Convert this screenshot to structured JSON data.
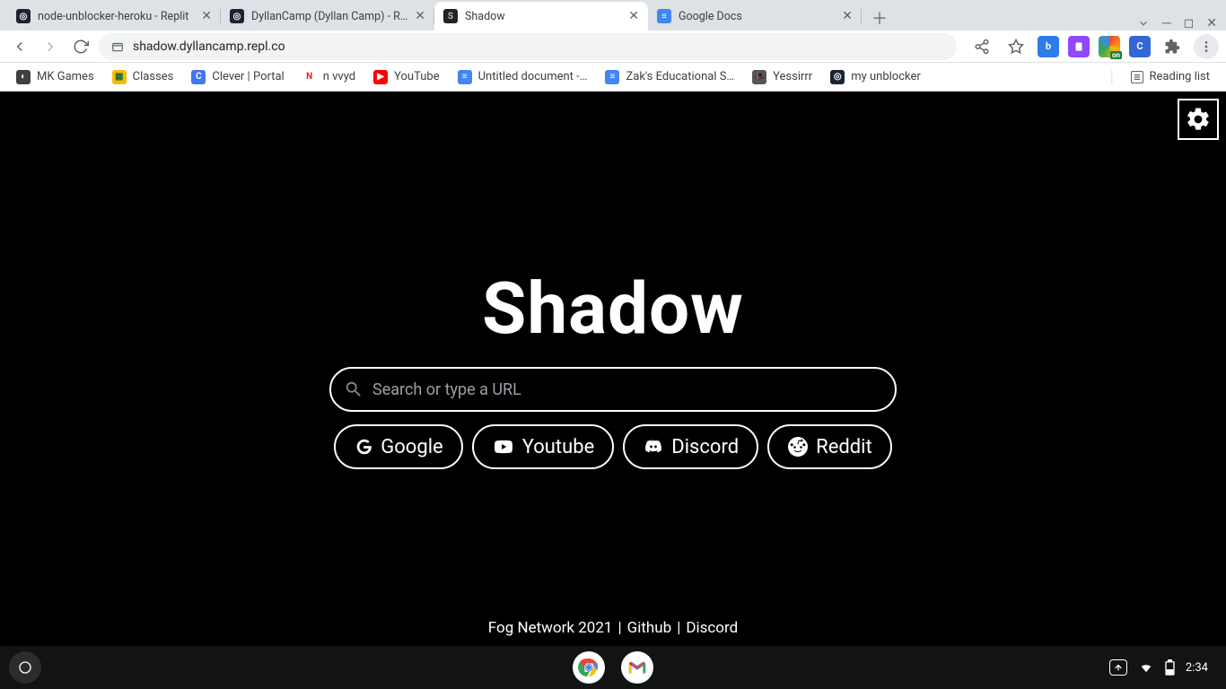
{
  "tabs": [
    {
      "title": "node-unblocker-heroku - Replit",
      "favicon_bg": "#1c2333",
      "favicon_text": "◎",
      "favicon_color": "#fff",
      "active": false
    },
    {
      "title": "DyllanCamp (Dyllan Camp) - Repl",
      "favicon_bg": "#1c2333",
      "favicon_text": "◎",
      "favicon_color": "#fff",
      "active": false
    },
    {
      "title": "Shadow",
      "favicon_bg": "#222",
      "favicon_text": "S",
      "favicon_color": "#bbb",
      "active": true
    },
    {
      "title": "Google Docs",
      "favicon_bg": "#4285f4",
      "favicon_text": "≡",
      "favicon_color": "#fff",
      "active": false
    }
  ],
  "url": "shadow.dyllancamp.repl.co",
  "toolbar_icons": {
    "share": "share-icon",
    "bookmark": "star-icon"
  },
  "extensions": [
    {
      "name": "ext-b",
      "bg": "#2b7de9",
      "text": "b",
      "color": "#fff"
    },
    {
      "name": "ext-tw",
      "bg": "#9146ff",
      "text": "▮",
      "color": "#fff"
    },
    {
      "name": "ext-cookie",
      "bg": "linear-gradient(135deg,#f6c026,#ea4335,#34a853,#4285f4)",
      "text": "",
      "color": "#fff",
      "badge": "on"
    },
    {
      "name": "ext-c",
      "bg": "#3367d6",
      "text": "C",
      "color": "#fff"
    }
  ],
  "bookmarks": [
    {
      "label": "MK Games",
      "icon_bg": "#3c4043",
      "icon_text": "◐",
      "icon_color": "#fff"
    },
    {
      "label": "Classes",
      "icon_bg": "#fbbc04",
      "icon_text": "▦",
      "icon_color": "#1e6b3a"
    },
    {
      "label": "Clever | Portal",
      "icon_bg": "#4274f4",
      "icon_text": "C",
      "icon_color": "#fff"
    },
    {
      "label": "n vvyd",
      "icon_bg": "#ffffff",
      "icon_text": "N",
      "icon_color": "#e8232a"
    },
    {
      "label": "YouTube",
      "icon_bg": "#ff0000",
      "icon_text": "▶",
      "icon_color": "#fff"
    },
    {
      "label": "Untitled document -…",
      "icon_bg": "#4285f4",
      "icon_text": "≡",
      "icon_color": "#fff"
    },
    {
      "label": "Zak's Educational S…",
      "icon_bg": "#4285f4",
      "icon_text": "≡",
      "icon_color": "#fff"
    },
    {
      "label": "Yessirrr",
      "icon_bg": "#555",
      "icon_text": "🎩",
      "icon_color": "#fff"
    },
    {
      "label": "my unblocker",
      "icon_bg": "#1c2333",
      "icon_text": "◎",
      "icon_color": "#fff"
    }
  ],
  "reading_list_label": "Reading list",
  "page": {
    "title": "Shadow",
    "search_placeholder": "Search or type a URL",
    "quicklinks": [
      {
        "label": "Google",
        "icon": "google"
      },
      {
        "label": "Youtube",
        "icon": "youtube"
      },
      {
        "label": "Discord",
        "icon": "discord"
      },
      {
        "label": "Reddit",
        "icon": "reddit"
      }
    ],
    "footer": {
      "copyright": "Fog Network 2021",
      "link1": "Github",
      "link2": "Discord",
      "sep": " | "
    }
  },
  "shelf": {
    "time": "2:34"
  }
}
